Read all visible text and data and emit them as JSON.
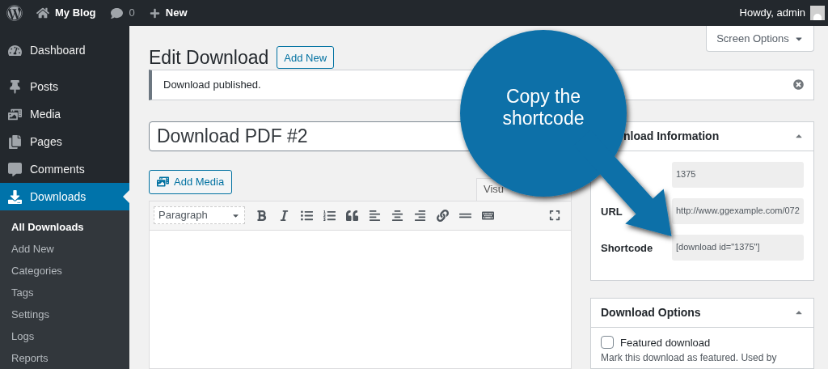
{
  "topbar": {
    "site": "My Blog",
    "comments": "0",
    "new": "New",
    "greeting": "Howdy, admin"
  },
  "sidebar": {
    "items": [
      {
        "label": "Dashboard",
        "selected": false
      },
      {
        "label": "Posts",
        "selected": false
      },
      {
        "label": "Media",
        "selected": false
      },
      {
        "label": "Pages",
        "selected": false
      },
      {
        "label": "Comments",
        "selected": false
      },
      {
        "label": "Downloads",
        "selected": true
      }
    ],
    "submenu": [
      {
        "label": "All Downloads",
        "selected": true
      },
      {
        "label": "Add New",
        "selected": false
      },
      {
        "label": "Categories",
        "selected": false
      },
      {
        "label": "Tags",
        "selected": false
      },
      {
        "label": "Settings",
        "selected": false
      },
      {
        "label": "Logs",
        "selected": false
      },
      {
        "label": "Reports",
        "selected": false
      }
    ]
  },
  "screen_options": "Screen Options",
  "page": {
    "title": "Edit Download",
    "add_new": "Add New",
    "notice": "Download published.",
    "post_title": "Download PDF #2",
    "add_media": "Add Media",
    "editor_tab": "Visu",
    "format": "Paragraph"
  },
  "info_box": {
    "title": "nload Information",
    "fields": [
      {
        "value": "1375"
      },
      {
        "label": "URL",
        "value": "http://www.ggexample.com/072"
      },
      {
        "label": "Shortcode",
        "value": "[download id=\"1375\"]"
      }
    ]
  },
  "options_box": {
    "title": "Download Options",
    "checkbox": {
      "label": "Featured download",
      "checked": false
    },
    "description": "Mark this download as featured. Used by"
  },
  "callout": {
    "text": "Copy the shortcode"
  }
}
